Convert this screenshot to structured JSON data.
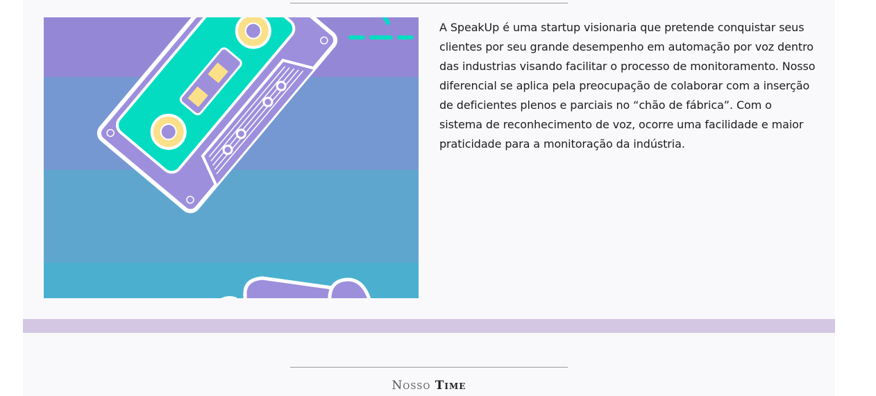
{
  "about": {
    "text": "A SpeakUp é uma startup visionaria que pretende conquistar seus clientes por seu grande desempenho em automação por voz dentro das industrias visando facilitar o processo de monitoramento. Nosso diferencial se aplica pela preocupação de colaborar com a inserção de deficientes plenos e parciais no “chão de fábrica”. Com o sistema de reconhecimento de voz, ocorre uma facilidade e maior praticidade para a monitoração da indústria."
  },
  "illustration": {
    "icon": "cassette-tape-illustration",
    "colors": {
      "band1": "#9488d6",
      "band2": "#7598d2",
      "band3": "#5fa6cf",
      "band4": "#4bb0cf",
      "tape_body": "#9d8fdc",
      "label": "#04dcc2",
      "reel": "#fbe08a",
      "outline": "#ffffff"
    }
  },
  "section": {
    "title_light": "Nosso",
    "title_bold": "Time"
  },
  "colors": {
    "card_background": "#f9f9fc",
    "divider_band": "#d4c7e3",
    "text": "#1c1c1c"
  }
}
